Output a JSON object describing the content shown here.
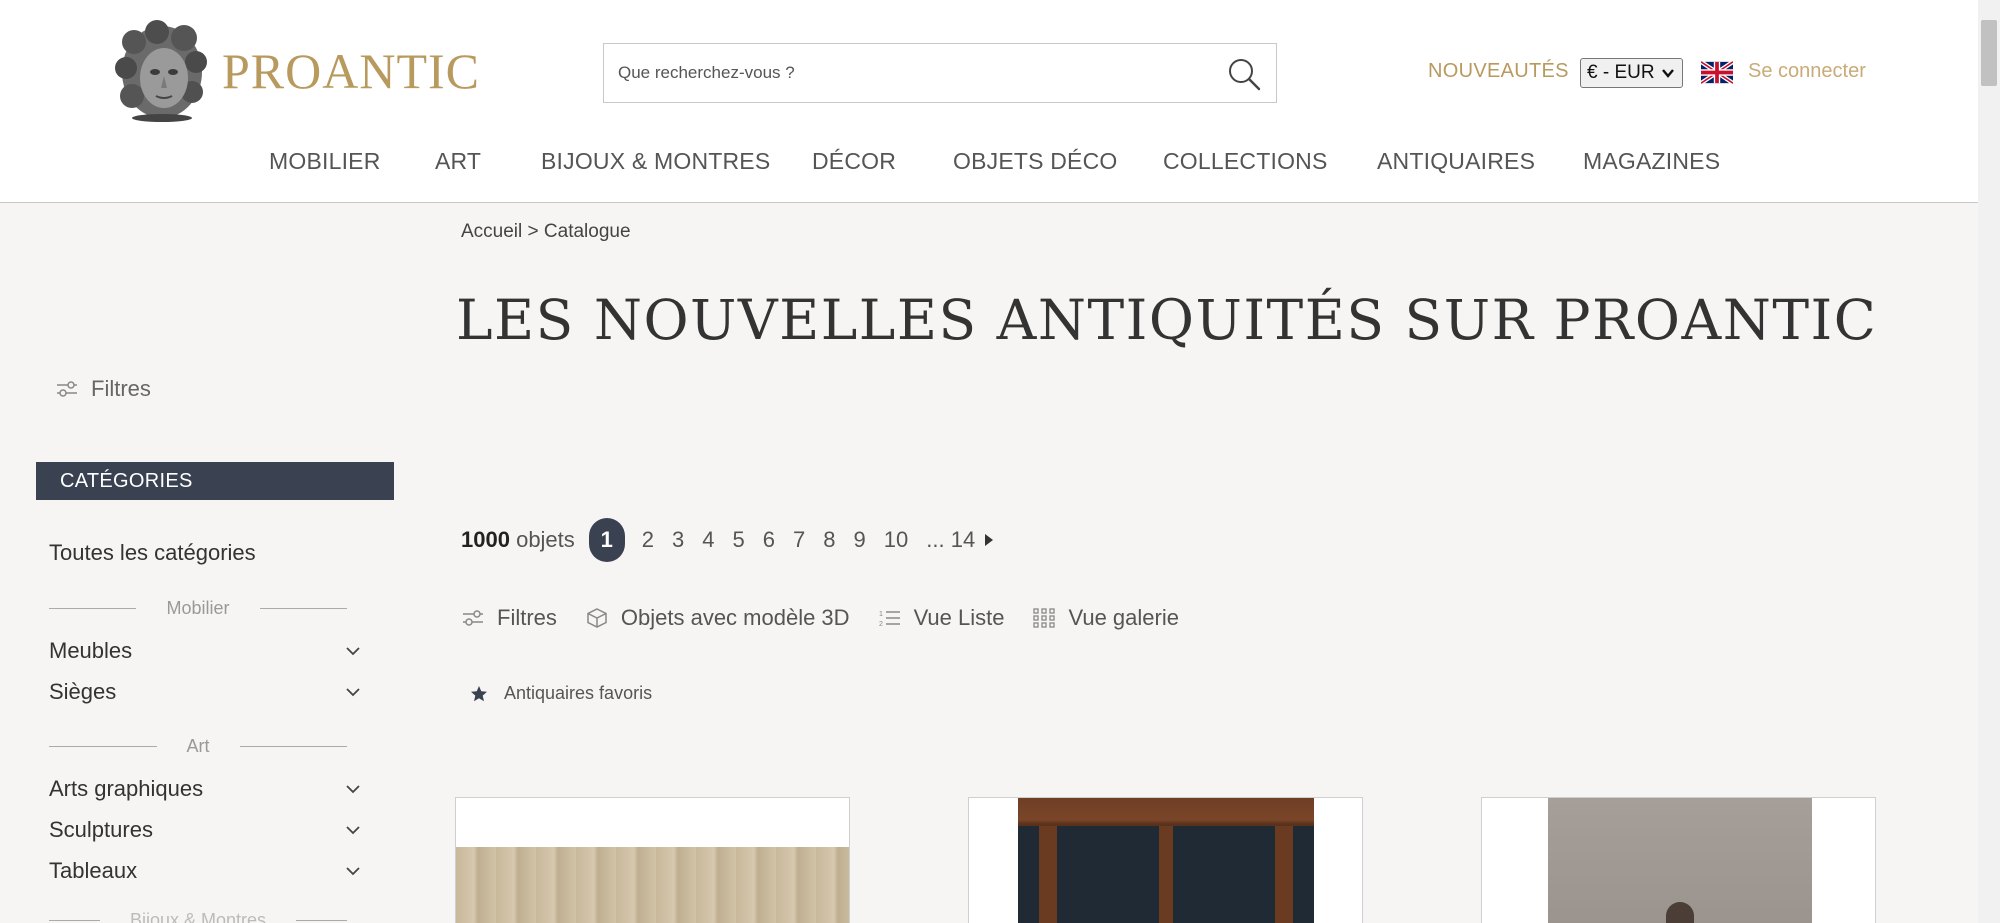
{
  "brand": {
    "name": "PROANTIC",
    "color": "#b89a5e"
  },
  "search": {
    "placeholder": "Que recherchez-vous ?"
  },
  "header": {
    "nouveautes": "NOUVEAUTÉS",
    "currency": "€ - EUR",
    "language_flag": "uk-flag-icon",
    "login": "Se connecter"
  },
  "nav": [
    "MOBILIER",
    "ART",
    "BIJOUX & MONTRES",
    "DÉCOR",
    "OBJETS DÉCO",
    "COLLECTIONS",
    "ANTIQUAIRES",
    "MAGAZINES"
  ],
  "sidebar": {
    "filters": "Filtres",
    "categories_title": "CATÉGORIES",
    "all_categories": "Toutes les catégories",
    "groups": [
      {
        "label": "Mobilier",
        "items": [
          "Meubles",
          "Sièges"
        ]
      },
      {
        "label": "Art",
        "items": [
          "Arts graphiques",
          "Sculptures",
          "Tableaux"
        ]
      },
      {
        "label": "Bijoux & Montres",
        "items": []
      }
    ]
  },
  "breadcrumb": {
    "home": "Accueil",
    "separator": ">",
    "current": "Catalogue"
  },
  "page": {
    "title": "LES NOUVELLES ANTIQUITÉS SUR PROANTIC"
  },
  "pagination": {
    "count_number": "1000",
    "count_label": "objets",
    "current": "1",
    "pages": [
      "2",
      "3",
      "4",
      "5",
      "6",
      "7",
      "8",
      "9",
      "10",
      "... 14"
    ]
  },
  "toolbar": {
    "filters": "Filtres",
    "objects_3d": "Objets avec modèle 3D",
    "list_view": "Vue Liste",
    "gallery_view": "Vue galerie"
  },
  "favorites": "Antiquaires favoris",
  "colors": {
    "dark": "#3a4150",
    "gold": "#b89a5e",
    "gold_light": "#c8ab78",
    "background": "#f6f5f3"
  }
}
